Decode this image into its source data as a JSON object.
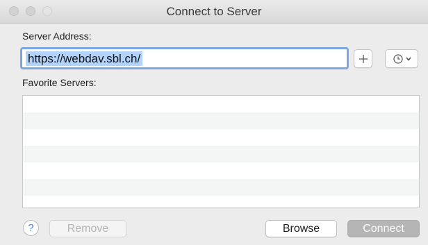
{
  "window": {
    "title": "Connect to Server"
  },
  "server_address": {
    "label": "Server Address:",
    "value": "https://webdav.sbl.ch/",
    "selected_text": "https://webdav.sbl.ch/"
  },
  "buttons": {
    "add_icon": "plus-icon",
    "recent_icon": "clock-icon",
    "recent_dropdown_icon": "chevron-down-icon",
    "help_label": "?",
    "remove_label": "Remove",
    "browse_label": "Browse",
    "connect_label": "Connect"
  },
  "favorites": {
    "label": "Favorite Servers:",
    "items": []
  },
  "colors": {
    "focus_ring": "#7ba6e0",
    "selection": "#b3d3fb",
    "help_accent": "#3b7ee8",
    "connect_disabled": "#b5b5b5"
  }
}
